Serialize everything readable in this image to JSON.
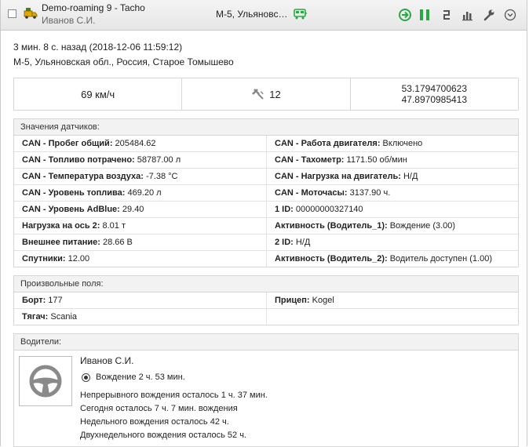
{
  "header": {
    "title": "Demo-roaming 9 - Tacho",
    "driver": "Иванов С.И.",
    "address_short": "М-5, Ульяновс…"
  },
  "info": {
    "time": "3 мин. 8 с. назад (2018-12-06 11:59:12)",
    "address": "М-5, Ульяновская обл., Россия, Старое Томышево"
  },
  "stats": {
    "speed": "69 км/ч",
    "satellites": "12",
    "lat": "53.1794700623",
    "lon": "47.8970985413"
  },
  "sensors": {
    "title": "Значения датчиков:",
    "rows": [
      {
        "k": "CAN - Пробег общий:",
        "v": " 205484.62"
      },
      {
        "k": "CAN - Работа двигателя:",
        "v": " Включено"
      },
      {
        "k": "CAN - Топливо потрачено:",
        "v": " 58787.00 л"
      },
      {
        "k": "CAN - Тахометр:",
        "v": " 1171.50 об/мин"
      },
      {
        "k": "CAN - Температура воздуха:",
        "v": " -7.38 °C"
      },
      {
        "k": "CAN - Нагрузка на двигатель:",
        "v": " Н/Д"
      },
      {
        "k": "CAN - Уровень топлива:",
        "v": " 469.20 л"
      },
      {
        "k": "CAN - Моточасы:",
        "v": " 3137.90 ч."
      },
      {
        "k": "CAN - Уровень AdBlue:",
        "v": " 29.40"
      },
      {
        "k": "1 ID:",
        "v": " 00000000327140"
      },
      {
        "k": "Нагрузка на ось 2:",
        "v": " 8.01 т"
      },
      {
        "k": "Активность (Водитель_1):",
        "v": " Вождение (3.00)"
      },
      {
        "k": "Внешнее питание:",
        "v": " 28.66 В"
      },
      {
        "k": "2 ID:",
        "v": " Н/Д"
      },
      {
        "k": "Спутники:",
        "v": " 12.00"
      },
      {
        "k": "Активность (Водитель_2):",
        "v": " Водитель доступен (1.00)"
      }
    ]
  },
  "custom": {
    "title": "Произвольные поля:",
    "rows": [
      {
        "k": "Борт:",
        "v": " 177"
      },
      {
        "k": "Прицеп:",
        "v": " Kogel"
      },
      {
        "k": "Тягач:",
        "v": " Scania"
      },
      {
        "k": "",
        "v": ""
      }
    ]
  },
  "drivers": {
    "title": "Водители:",
    "name": "Иванов С.И.",
    "activity": "Вождение 2 ч. 53 мин.",
    "lines": [
      "Непрерывного вождения осталось 1 ч. 37 мин.",
      "Сегодня осталось 7 ч. 7 мин. вождения",
      "Недельного вождения осталось 42 ч.",
      "Двухнедельного вождения осталось 52 ч."
    ]
  },
  "colors": {
    "accent_green": "#2aa845",
    "icon_gray": "#555555"
  },
  "icons": [
    "checkbox",
    "truck-icon",
    "bus-icon",
    "send-command-icon",
    "pause-icon",
    "route-icon",
    "chart-icon",
    "wrench-icon",
    "dropdown-icon",
    "satellite-icon",
    "steering-wheel-icon",
    "radio-icon"
  ]
}
